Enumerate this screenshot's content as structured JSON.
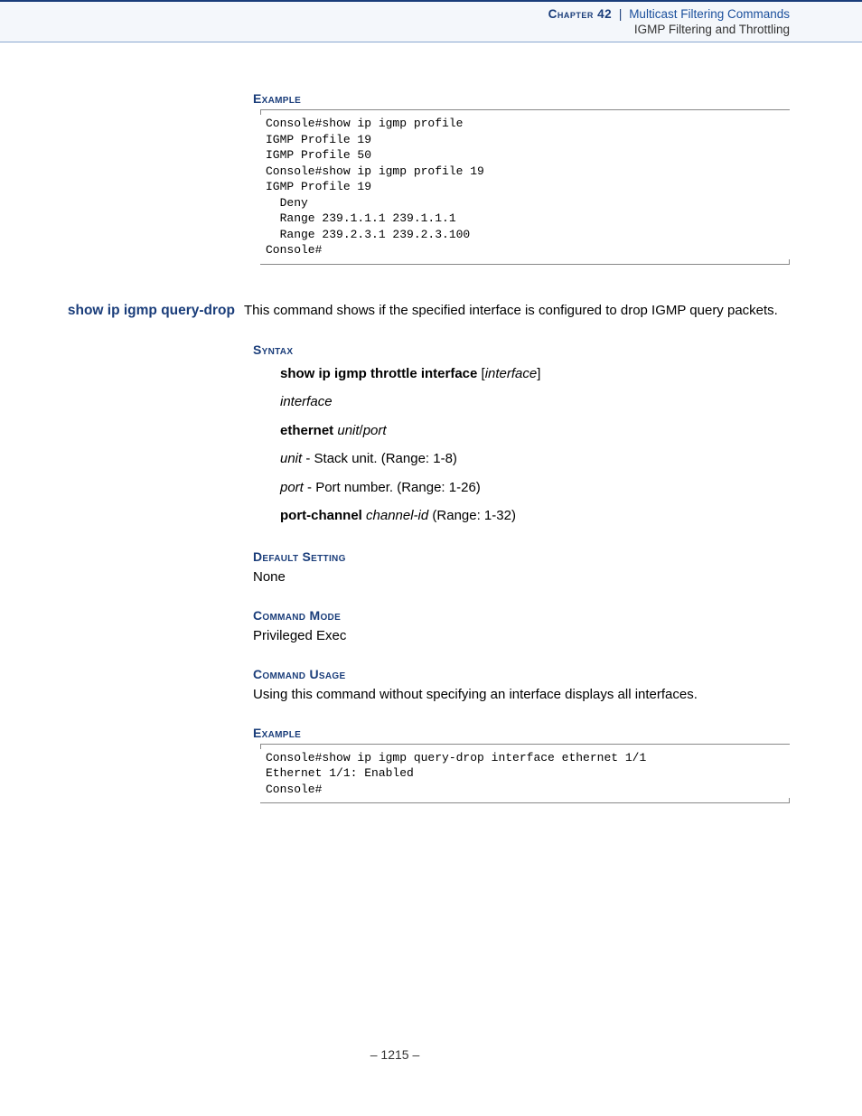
{
  "header": {
    "chapter": "Chapter 42",
    "separator": "|",
    "title": "Multicast Filtering Commands",
    "subtitle": "IGMP Filtering and Throttling"
  },
  "sections": {
    "example1_heading": "Example",
    "example1_text": "Console#show ip igmp profile\nIGMP Profile 19\nIGMP Profile 50\nConsole#show ip igmp profile 19\nIGMP Profile 19\n  Deny\n  Range 239.1.1.1 239.1.1.1\n  Range 239.2.3.1 239.2.3.100\nConsole#",
    "cmd_name": "show ip igmp query-drop",
    "cmd_desc": "This command shows if the specified interface is configured to drop IGMP query packets.",
    "syntax_heading": "Syntax",
    "syntax": {
      "line1_cmd": "show ip igmp throttle interface",
      "line1_arg_open": "[",
      "line1_arg": "interface",
      "line1_arg_close": "]",
      "interface_label": "interface",
      "ethernet_label": "ethernet",
      "ethernet_arg1": "unit",
      "ethernet_sep": "/",
      "ethernet_arg2": "port",
      "unit_label": "unit",
      "unit_desc": " - Stack unit. (Range: 1-8)",
      "port_label": "port",
      "port_desc": " - Port number. (Range: 1-26)",
      "pc_label": "port-channel",
      "pc_arg": "channel-id",
      "pc_desc": " (Range: 1-32)"
    },
    "default_heading": "Default Setting",
    "default_body": "None",
    "mode_heading": "Command Mode",
    "mode_body": "Privileged Exec",
    "usage_heading": "Command Usage",
    "usage_body": "Using this command without specifying an interface displays all interfaces.",
    "example2_heading": "Example",
    "example2_text": "Console#show ip igmp query-drop interface ethernet 1/1\nEthernet 1/1: Enabled\nConsole#"
  },
  "footer": {
    "page": "–  1215  –"
  }
}
